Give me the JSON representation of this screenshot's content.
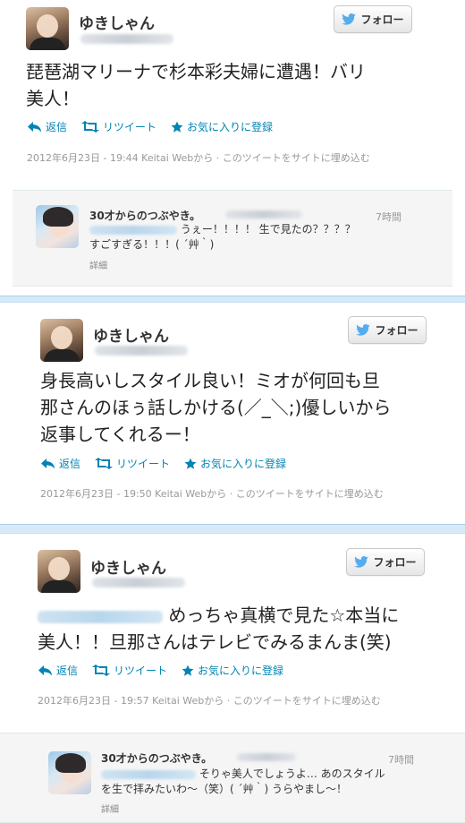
{
  "tweets": [
    {
      "name": "ゆきしゃん",
      "follow_label": "フォロー",
      "text_lines": [
        "琵琶湖マリーナで杉本彩夫婦に遭遇！バリ",
        "美人！"
      ],
      "actions": {
        "reply": "返信",
        "retweet": "リツイート",
        "favorite": "お気に入りに登録"
      },
      "meta": "2012年6月23日 - 19:44 Keitai Webから · このツイートをサイトに埋め込む"
    },
    {
      "name": "ゆきしゃん",
      "follow_label": "フォロー",
      "text_lines": [
        "身長高いしスタイル良い！ミオが何回も旦",
        "那さんのほぅ話しかける(／_＼;)優しいから",
        "返事してくれるー！"
      ],
      "actions": {
        "reply": "返信",
        "retweet": "リツイート",
        "favorite": "お気に入りに登録"
      },
      "meta": "2012年6月23日 - 19:50 Keitai Webから · このツイートをサイトに埋め込む"
    },
    {
      "name": "ゆきしゃん",
      "follow_label": "フォロー",
      "text_lines": [
        " めっちゃ真横で見た☆本当に",
        "美人！！旦那さんはテレビでみるまんま(笑)"
      ],
      "actions": {
        "reply": "返信",
        "retweet": "リツイート",
        "favorite": "お気に入りに登録"
      },
      "meta": "2012年6月23日 - 19:57 Keitai Webから · このツイートをサイトに埋め込む"
    }
  ],
  "replies": [
    {
      "name": "30才からのつぶやき。",
      "time": "7時間",
      "line1": " うぇー！！！！ 生で見たの？？？？",
      "line2": "すごすぎる！！！( ´艸｀)",
      "detail": "詳細"
    },
    {
      "name": "30才からのつぶやき。",
      "time": "7時間",
      "line1": " そりゃ美人でしょうよ… あのスタイル",
      "line2": "を生で拝みたいわ〜（笑）( ´艸｀) うらやまし〜！",
      "detail": "詳細"
    }
  ],
  "colors": {
    "link": "#0084b4",
    "separator": "#c0deed",
    "bird": "#55acee"
  },
  "icons": [
    "reply-icon",
    "retweet-icon",
    "star-icon",
    "bird-icon"
  ]
}
